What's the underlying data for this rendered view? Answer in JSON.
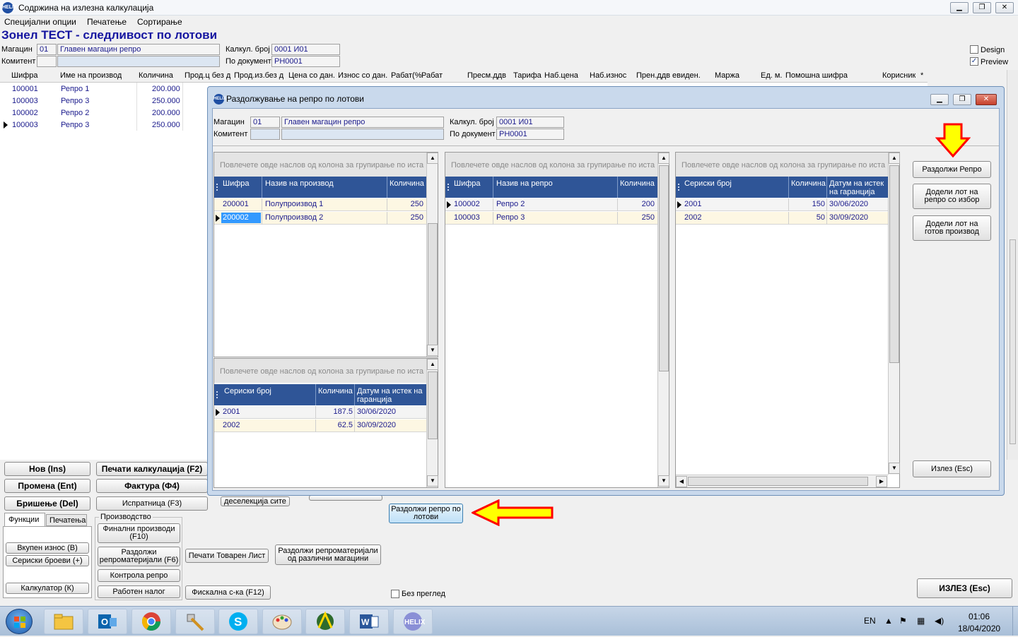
{
  "window": {
    "title": "Содржина на излезна калкулација",
    "app_icon": "HELIX",
    "minimize": "▁",
    "restore": "❐",
    "close": "✕"
  },
  "menu": [
    "Специјални опции",
    "Печатење",
    "Сортирање"
  ],
  "page_title": "Зонел ТЕСТ - следливост по лотови",
  "header": {
    "warehouse_label": "Магацин",
    "warehouse_code": "01",
    "warehouse_name": "Главен магацин репро",
    "client_label": "Комитент",
    "calc_label": "Калкул. број",
    "calc_value": "0001   И01",
    "doc_label": "По документ",
    "doc_value": "РН0001",
    "design_label": "Design",
    "preview_label": "Preview"
  },
  "main_grid": {
    "columns": [
      "Шифра",
      "Име на производ",
      "Количина",
      "Прод.ц без д",
      "Прод.из.без д",
      "Цена со дан.",
      "Износ со дан.",
      "Рабат(%",
      "Рабат",
      "Пресм.ддв",
      "Тарифа",
      "Наб.цена",
      "Наб.износ",
      "Прен.ддв евиден.",
      "Маржа",
      "Ед. м.",
      "Помошна шифра",
      "Корисник",
      "*"
    ],
    "rows": [
      {
        "code": "100001",
        "name": "Репро 1",
        "qty": "200.000"
      },
      {
        "code": "100003",
        "name": "Репро 3",
        "qty": "250.000"
      },
      {
        "code": "100002",
        "name": "Репро 2",
        "qty": "200.000"
      },
      {
        "code": "100003",
        "name": "Репро 3",
        "qty": "250.000"
      }
    ]
  },
  "left_buttons": {
    "new": "Нов (Ins)",
    "change": "Промена (Ent)",
    "delete": "Бришење (Del)",
    "print_calc": "Печати калкулација (F2)",
    "invoice": "Фактура (Ф4)",
    "delivery": "Испратница (F3)",
    "deselect": "деселекција сите",
    "lot_btn": "Раздолжи репро по лотови"
  },
  "tabs": {
    "functions": "Функции",
    "printing": "Печатења"
  },
  "production": {
    "group_label": "Производство",
    "final": "Финални производи (F10)",
    "raw": "Раздолжи репроматеријали (F6)",
    "control": "Контрола репро",
    "work_order": "Работен налог",
    "print_cargo": "Печати Товарен Лист",
    "diff_wh": "Раздолжи репроматеријали од различни магацини",
    "fiscal": "Фискална с-ка (F12)"
  },
  "func_buttons": {
    "total": "Вкупен износ (В)",
    "serials": "Сериски броеви (+)",
    "calculator": "Калкулатор (К)"
  },
  "no_preview": "Без преглед",
  "exit_main": "ИЗЛЕЗ (Esc)",
  "dialog": {
    "title": "Раздолжување на репро по лотови",
    "warehouse_label": "Магацин",
    "warehouse_code": "01",
    "warehouse_name": "Главен магацин репро",
    "client_label": "Комитент",
    "calc_label": "Калкул. број",
    "calc_value": "0001   И01",
    "doc_label": "По документ",
    "doc_value": "РН0001",
    "group_hint": "Повлечете овде наслов од колона за групирање по иста",
    "products_grid": {
      "columns": [
        "Шифра",
        "Назив на производ",
        "Количина"
      ],
      "rows": [
        {
          "code": "200001",
          "name": "Полупроизвод 1",
          "qty": "250"
        },
        {
          "code": "200002",
          "name": "Полупроизвод 2",
          "qty": "250"
        }
      ]
    },
    "product_lots_grid": {
      "columns": [
        "Сериски број",
        "Количина",
        "Датум на истек на гаранција"
      ],
      "rows": [
        {
          "serial": "2001",
          "qty": "187.5",
          "date": "30/06/2020"
        },
        {
          "serial": "2002",
          "qty": "62.5",
          "date": "30/09/2020"
        }
      ]
    },
    "repro_grid": {
      "columns": [
        "Шифра",
        "Назив на репро",
        "Количина"
      ],
      "rows": [
        {
          "code": "100002",
          "name": "Репро 2",
          "qty": "200"
        },
        {
          "code": "100003",
          "name": "Репро 3",
          "qty": "250"
        }
      ]
    },
    "repro_lots_grid": {
      "columns": [
        "Сериски број",
        "Количина",
        "Датум на истек на гаранција"
      ],
      "rows": [
        {
          "serial": "2001",
          "qty": "150",
          "date": "30/06/2020"
        },
        {
          "serial": "2002",
          "qty": "50",
          "date": "30/09/2020"
        }
      ]
    },
    "btn_repro": "Раздолжи Репро",
    "btn_lot_select": "Додели лот на репро со избор",
    "btn_lot_finished": "Додели лот на готов производ",
    "btn_exit": "Излез (Esc)"
  },
  "taskbar": {
    "apps": [
      "start-icon",
      "file-explorer-icon",
      "outlook-icon",
      "chrome-icon",
      "tools-icon",
      "skype-icon",
      "paint-icon",
      "helix-tool-icon",
      "word-icon",
      "helix-icon"
    ],
    "lang": "EN",
    "time": "01:06",
    "date": "18/04/2020"
  },
  "colors": {
    "grid_header": "#2f5597",
    "highlight": "#fdf7e3",
    "selected": "#3399ff",
    "arrow_fill": "#ffff00",
    "arrow_stroke": "#ff0000",
    "title_blue": "#1515a0"
  }
}
